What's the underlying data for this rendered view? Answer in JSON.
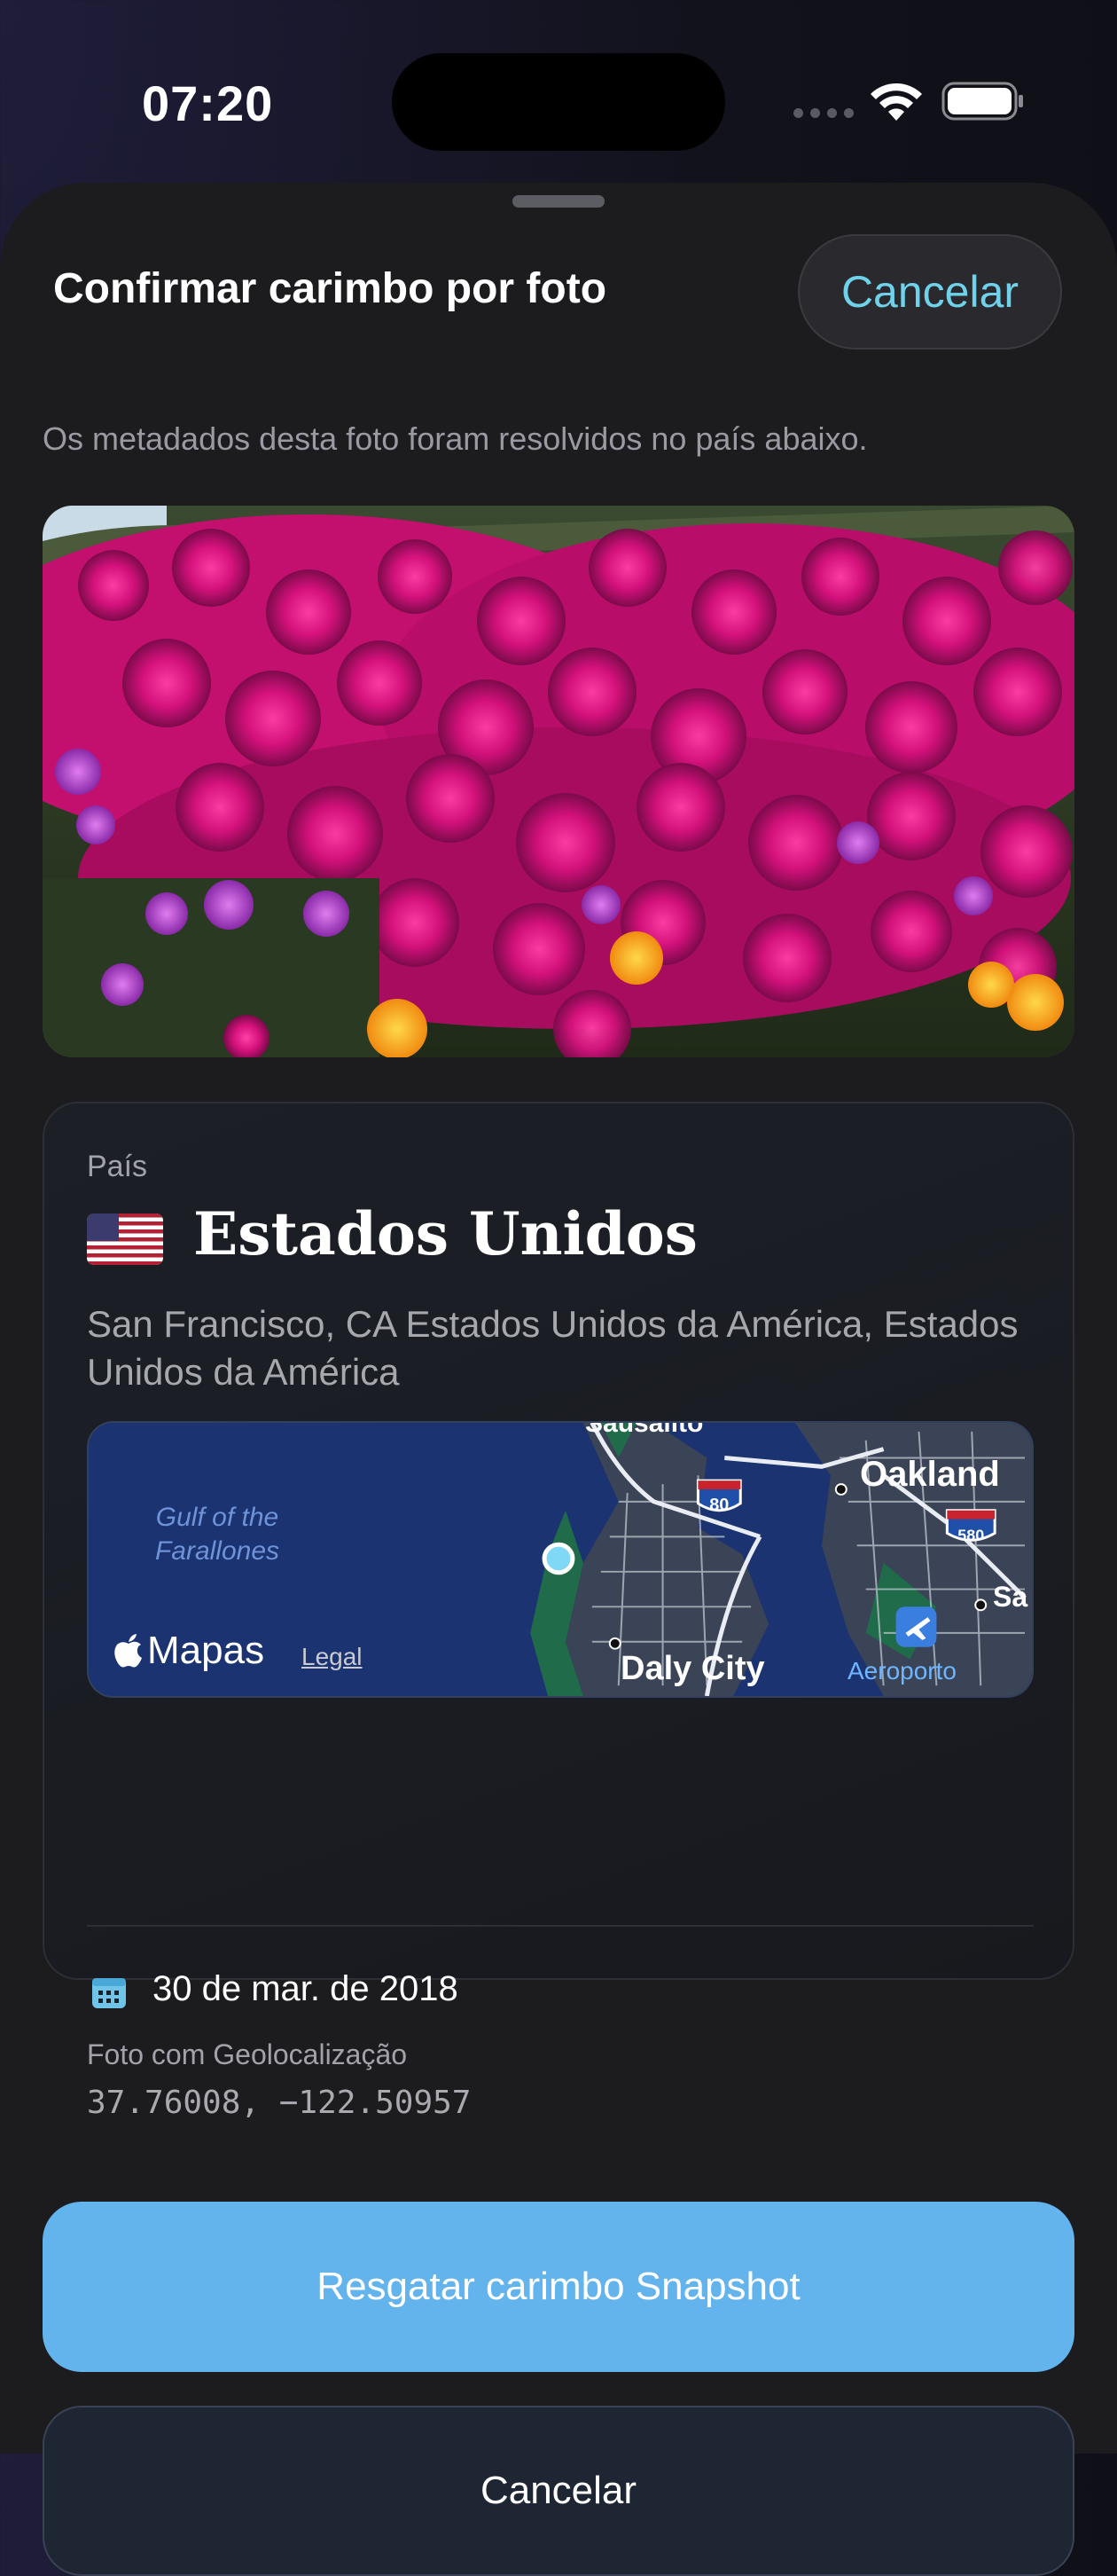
{
  "status_bar": {
    "time": "07:20"
  },
  "header": {
    "title": "Confirmar carimbo por foto",
    "cancel_label": "Cancelar"
  },
  "subtitle": "Os metadados desta foto foram resolvidos no país abaixo.",
  "card": {
    "country_label": "País",
    "country_name": "Estados Unidos",
    "address": "San Francisco, CA Estados Unidos da América, Estados Unidos da América",
    "map": {
      "gulf_label": "Gulf of the Farallones",
      "brand": "Mapas",
      "legal": "Legal",
      "labels": {
        "sausalito": "Sausalito",
        "oakland": "Oakland",
        "daly_city": "Daly City",
        "sa": "Sa",
        "aeroporto": "Aeroporto",
        "shield_80": "80",
        "shield_580": "580"
      }
    },
    "date": "30 de mar. de 2018",
    "geo_label": "Foto com Geolocalização",
    "coordinates": "37.76008, −122.50957"
  },
  "actions": {
    "primary": "Resgatar carimbo Snapshot",
    "secondary": "Cancelar"
  },
  "colors": {
    "accent": "#6fd2ea",
    "primary_button": "#63b3ec",
    "sheet": "#1c1c1f"
  }
}
